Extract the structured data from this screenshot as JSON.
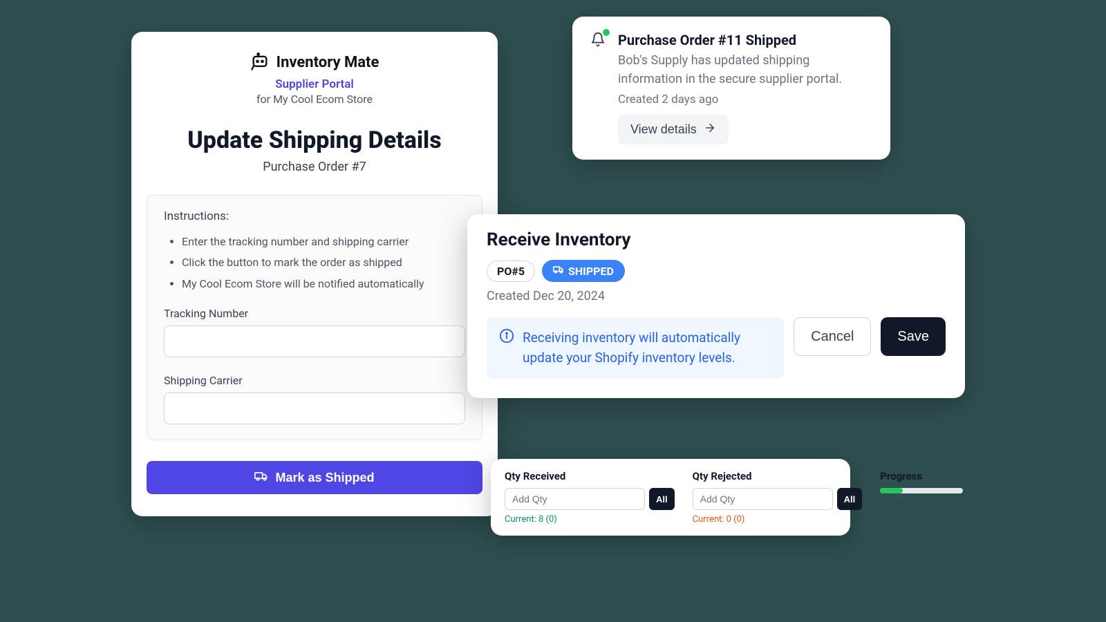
{
  "shipping": {
    "brand": "Inventory Mate",
    "portal_link": "Supplier Portal",
    "store_prefix": "for ",
    "store_name": "My Cool Ecom Store",
    "title": "Update Shipping Details",
    "po_subtitle": "Purchase Order #7",
    "instructions_label": "Instructions:",
    "instructions": [
      "Enter the tracking number and shipping carrier",
      "Click the button to mark the order as shipped",
      "My Cool Ecom Store will be notified automatically"
    ],
    "tracking_label": "Tracking Number",
    "carrier_label": "Shipping Carrier",
    "mark_btn": "Mark as Shipped"
  },
  "notification": {
    "title": "Purchase Order #11 Shipped",
    "body": "Bob's Supply has updated shipping information in the secure supplier portal.",
    "meta": "Created 2 days ago",
    "view_btn": "View details"
  },
  "receive": {
    "title": "Receive Inventory",
    "po_badge": "PO#5",
    "shipped_badge": "SHIPPED",
    "created": "Created Dec 20, 2024",
    "info_text": "Receiving inventory will automatically update your Shopify inventory levels.",
    "cancel": "Cancel",
    "save": "Save"
  },
  "qty": {
    "received_label": "Qty Received",
    "rejected_label": "Qty Rejected",
    "progress_label": "Progress",
    "placeholder": "Add Qty",
    "all_btn": "All",
    "current_received": "Current: 8 (0)",
    "current_rejected": "Current: 0 (0)",
    "progress_text": "8 / 29",
    "progress_pct": 27.6
  }
}
